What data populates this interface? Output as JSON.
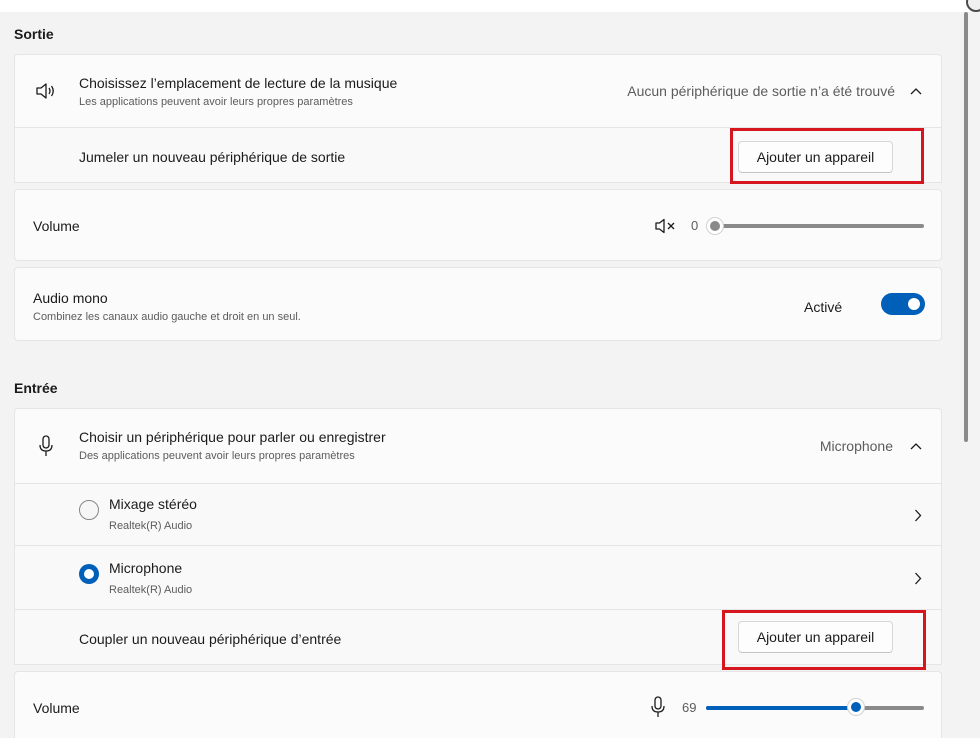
{
  "output": {
    "section_title": "Sortie",
    "location_row": {
      "icon": "speaker-icon",
      "title": "Choisissez l’emplacement de lecture de la musique",
      "description": "Les applications peuvent avoir leurs propres paramètres",
      "value": "Aucun périphérique de sortie n’a été trouvé",
      "expand_icon": "chevron-up-icon"
    },
    "pair_row": {
      "label": "Jumeler un nouveau périphérique de sortie",
      "button_label": "Ajouter un appareil"
    },
    "volume_row": {
      "label": "Volume",
      "icon": "speaker-muted-icon",
      "value": "0",
      "level_percent": 0
    },
    "mono_row": {
      "title": "Audio mono",
      "description": "Combinez les canaux audio gauche et droit en un seul.",
      "state_label": "Activé",
      "toggle_on": true
    }
  },
  "input": {
    "section_title": "Entrée",
    "device_row": {
      "icon": "microphone-icon",
      "title": "Choisir un périphérique pour parler ou enregistrer",
      "description": "Des applications peuvent avoir leurs propres paramètres",
      "value": "Microphone",
      "expand_icon": "chevron-up-icon"
    },
    "devices": [
      {
        "name": "Mixage stéréo",
        "driver": "Realtek(R) Audio",
        "selected": false
      },
      {
        "name": "Microphone",
        "driver": "Realtek(R) Audio",
        "selected": true
      }
    ],
    "pair_row": {
      "label": "Coupler un nouveau périphérique d’entrée",
      "button_label": "Ajouter un appareil"
    },
    "volume_row": {
      "label": "Volume",
      "icon": "microphone-icon",
      "value": "69",
      "level_percent": 69
    }
  },
  "colors": {
    "accent": "#005fb8",
    "highlight": "#d6161e",
    "background": "#f3f3f3",
    "card": "#fbfbfb"
  }
}
